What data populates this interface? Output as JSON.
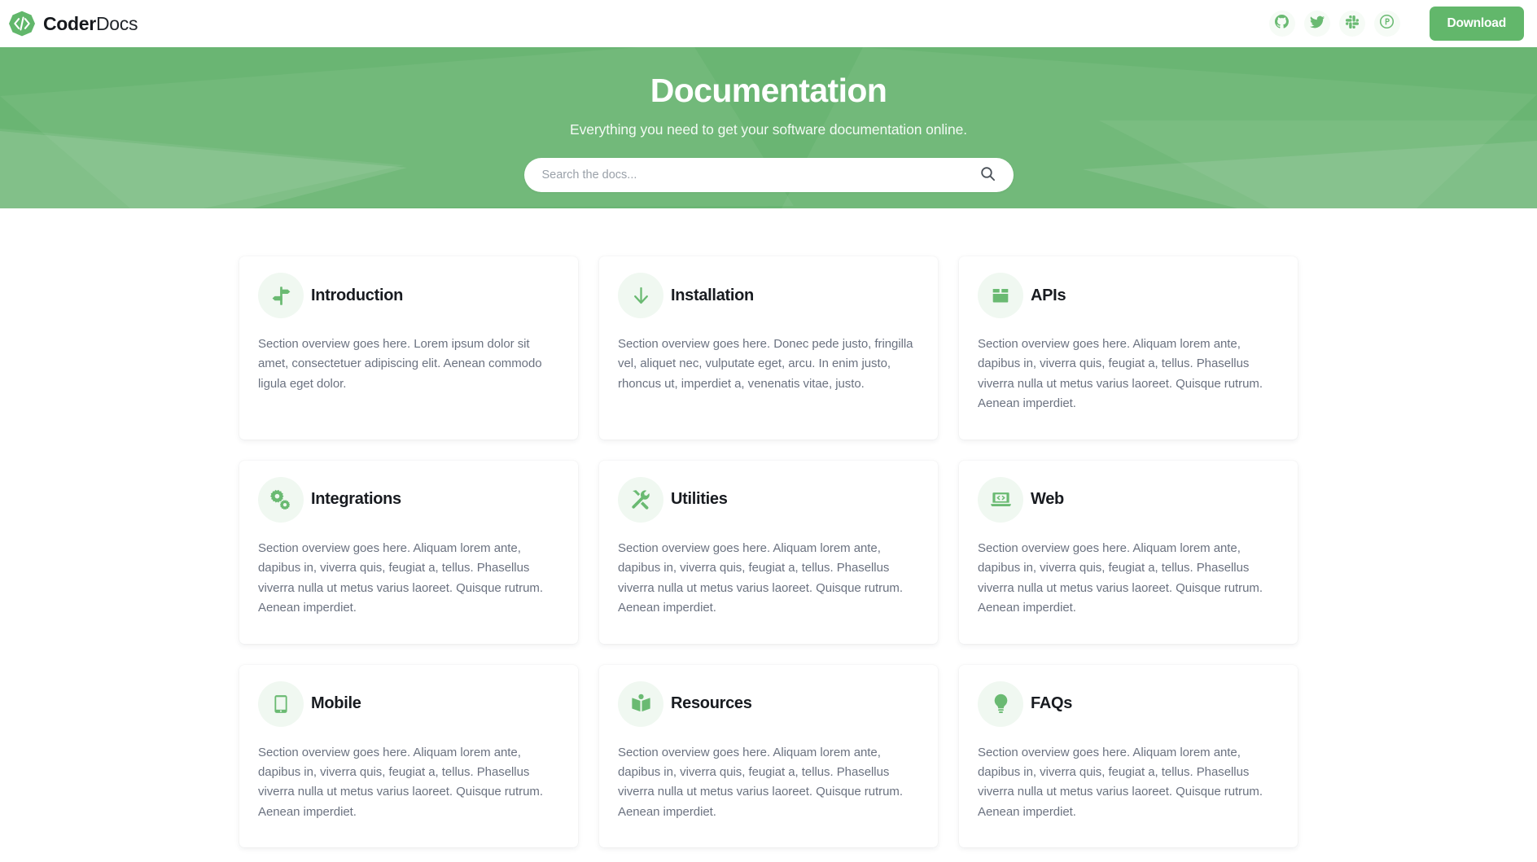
{
  "colors": {
    "brand_green": "#62b76b",
    "hero_green": "#6ab573",
    "icon_green": "#6aba72",
    "icon_bg": "#f0f8f1",
    "title_dark": "#181b20",
    "body_gray": "#6b7280"
  },
  "navbar": {
    "brand_strong": "Coder",
    "brand_light": "Docs",
    "logo_icon": "code-brackets-icon",
    "social": [
      {
        "name": "github",
        "icon": "github-icon",
        "label": "GitHub"
      },
      {
        "name": "twitter",
        "icon": "twitter-icon",
        "label": "Twitter"
      },
      {
        "name": "slack",
        "icon": "slack-icon",
        "label": "Slack"
      },
      {
        "name": "producthunt",
        "icon": "product-hunt-icon",
        "label": "Product Hunt"
      }
    ],
    "download_label": "Download"
  },
  "hero": {
    "title": "Documentation",
    "subtitle": "Everything you need to get your software documentation online.",
    "search_placeholder": "Search the docs...",
    "search_value": "",
    "search_icon": "search-icon"
  },
  "cards": [
    {
      "id": "introduction",
      "icon": "signpost-icon",
      "title": "Introduction",
      "body": "Section overview goes here. Lorem ipsum dolor sit amet, consectetuer adipiscing elit. Aenean commodo ligula eget dolor."
    },
    {
      "id": "installation",
      "icon": "arrow-down-icon",
      "title": "Installation",
      "body": "Section overview goes here. Donec pede justo, fringilla vel, aliquet nec, vulputate eget, arcu. In enim justo, rhoncus ut, imperdiet a, venenatis vitae, justo."
    },
    {
      "id": "apis",
      "icon": "box-icon",
      "title": "APIs",
      "body": "Section overview goes here. Aliquam lorem ante, dapibus in, viverra quis, feugiat a, tellus. Phasellus viverra nulla ut metus varius laoreet. Quisque rutrum. Aenean imperdiet."
    },
    {
      "id": "integrations",
      "icon": "gears-icon",
      "title": "Integrations",
      "body": "Section overview goes here. Aliquam lorem ante, dapibus in, viverra quis, feugiat a, tellus. Phasellus viverra nulla ut metus varius laoreet. Quisque rutrum. Aenean imperdiet."
    },
    {
      "id": "utilities",
      "icon": "tools-icon",
      "title": "Utilities",
      "body": "Section overview goes here. Aliquam lorem ante, dapibus in, viverra quis, feugiat a, tellus. Phasellus viverra nulla ut metus varius laoreet. Quisque rutrum. Aenean imperdiet."
    },
    {
      "id": "web",
      "icon": "laptop-code-icon",
      "title": "Web",
      "body": "Section overview goes here. Aliquam lorem ante, dapibus in, viverra quis, feugiat a, tellus. Phasellus viverra nulla ut metus varius laoreet. Quisque rutrum. Aenean imperdiet."
    },
    {
      "id": "mobile",
      "icon": "tablet-icon",
      "title": "Mobile",
      "body": "Section overview goes here. Aliquam lorem ante, dapibus in, viverra quis, feugiat a, tellus. Phasellus viverra nulla ut metus varius laoreet. Quisque rutrum. Aenean imperdiet."
    },
    {
      "id": "resources",
      "icon": "book-reader-icon",
      "title": "Resources",
      "body": "Section overview goes here. Aliquam lorem ante, dapibus in, viverra quis, feugiat a, tellus. Phasellus viverra nulla ut metus varius laoreet. Quisque rutrum. Aenean imperdiet."
    },
    {
      "id": "faqs",
      "icon": "lightbulb-icon",
      "title": "FAQs",
      "body": "Section overview goes here. Aliquam lorem ante, dapibus in, viverra quis, feugiat a, tellus. Phasellus viverra nulla ut metus varius laoreet. Quisque rutrum. Aenean imperdiet."
    }
  ]
}
